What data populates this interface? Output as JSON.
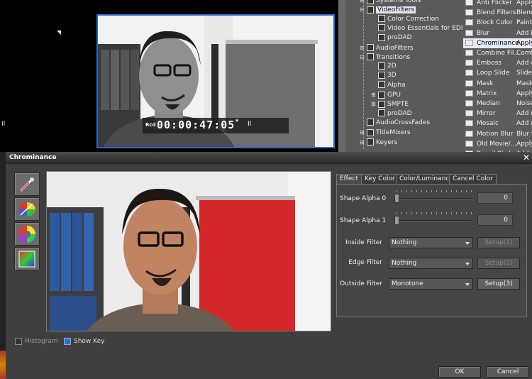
{
  "timecode": {
    "prefix": "Rcd",
    "value": "00:00:47:05",
    "marker": "*",
    "pause_glyph": "II"
  },
  "left_pause_glyph": "II",
  "tree": {
    "items": [
      {
        "label": "Systems Tools",
        "level": 0,
        "expand": "-"
      },
      {
        "label": "VideoFilters",
        "level": 0,
        "expand": "-",
        "selected": true
      },
      {
        "label": "Color Correction",
        "level": 1
      },
      {
        "label": "Video Essentials for EDIUS",
        "level": 1
      },
      {
        "label": "proDAD",
        "level": 1
      },
      {
        "label": "AudioFilters",
        "level": 0,
        "expand": "+"
      },
      {
        "label": "Transitions",
        "level": 0,
        "expand": "-"
      },
      {
        "label": "2D",
        "level": 1
      },
      {
        "label": "3D",
        "level": 1
      },
      {
        "label": "Alpha",
        "level": 1
      },
      {
        "label": "GPU",
        "level": 1,
        "expand": "+"
      },
      {
        "label": "SMPTE",
        "level": 1,
        "expand": "+"
      },
      {
        "label": "proDAD",
        "level": 1
      },
      {
        "label": "AudioCrossFades",
        "level": 0
      },
      {
        "label": "TitleMixers",
        "level": 0,
        "expand": "+"
      },
      {
        "label": "Keyers",
        "level": 0,
        "expand": "+"
      }
    ]
  },
  "filters": [
    {
      "name": "Anti Flicker",
      "desc": "Apply"
    },
    {
      "name": "Blend Filters",
      "desc": "Blend"
    },
    {
      "name": "Block Color",
      "desc": "Paint"
    },
    {
      "name": "Blur",
      "desc": "Add b"
    },
    {
      "name": "Chrominance",
      "desc": "Apply",
      "selected": true
    },
    {
      "name": "Combine Fil...",
      "desc": "Comb"
    },
    {
      "name": "Emboss",
      "desc": "Add e"
    },
    {
      "name": "Loop Slide",
      "desc": "Slide"
    },
    {
      "name": "Mask",
      "desc": "Mask"
    },
    {
      "name": "Matrix",
      "desc": "Apply"
    },
    {
      "name": "Median",
      "desc": "Noise"
    },
    {
      "name": "Mirror",
      "desc": "Add r"
    },
    {
      "name": "Mosaic",
      "desc": "Add n"
    },
    {
      "name": "Motion Blur",
      "desc": "Blur t"
    },
    {
      "name": "Old Movie/...",
      "desc": "Apply"
    },
    {
      "name": "Pencil Sket...",
      "desc": "Add"
    }
  ],
  "dialog": {
    "title": "Chrominance",
    "close_glyph": "✕",
    "tools": [
      "eyedropper-icon",
      "color-wheel-icon",
      "hue-wheel-icon",
      "gradient-square-icon"
    ],
    "histogram_label": "Histogram",
    "show_key_label": "Show Key",
    "histogram_checked": false,
    "show_key_checked": true,
    "tabs": [
      "Effect",
      "Key Color",
      "Color/Luminance",
      "Cancel Color"
    ],
    "active_tab": "Effect",
    "shape_alpha_0": {
      "label": "Shape Alpha 0",
      "value": "0",
      "level": 0
    },
    "shape_alpha_1": {
      "label": "Shape Alpha 1",
      "value": "0",
      "level": 0
    },
    "inside_filter": {
      "label": "Inside Filter",
      "value": "Nothing",
      "setup": "Setup(1)",
      "setup_enabled": false
    },
    "edge_filter": {
      "label": "Edge Filter",
      "value": "Nothing",
      "setup": "Setup(2)",
      "setup_enabled": false
    },
    "outside_filter": {
      "label": "Outside Filter",
      "value": "Monotone",
      "setup": "Setup(3)",
      "setup_enabled": true
    },
    "ok_label": "OK",
    "cancel_label": "Cancel"
  },
  "colors": {
    "accent_blue": "#2b64d6",
    "selection": "#dfe6f2",
    "dialog_bg": "#3f3f3f"
  }
}
